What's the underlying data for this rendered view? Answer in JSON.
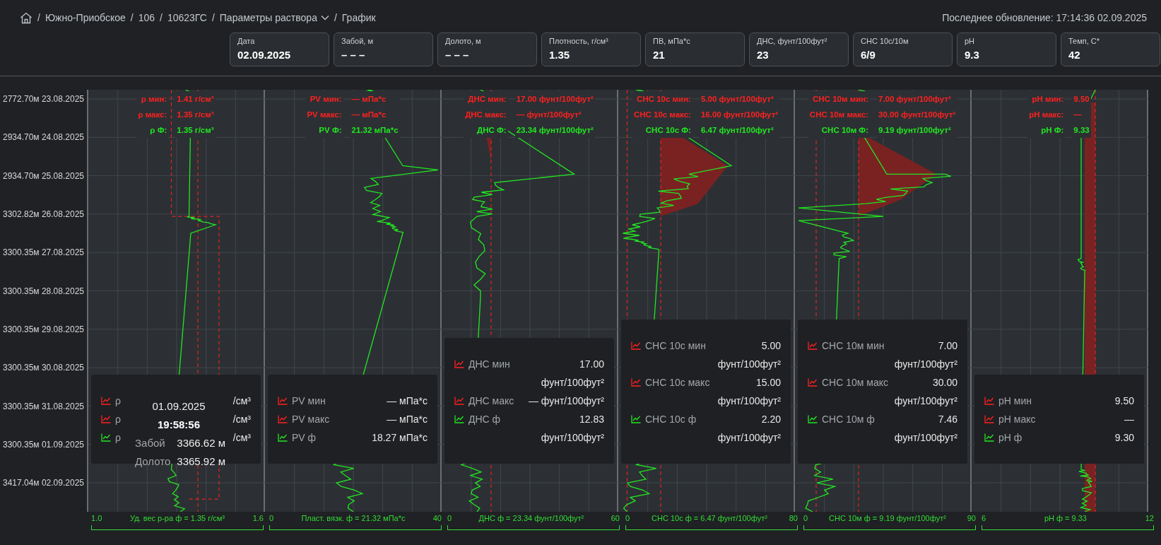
{
  "breadcrumb": {
    "separator": "/",
    "items": [
      {
        "label": "Южно-Приобское",
        "dropdown": false
      },
      {
        "label": "106",
        "dropdown": false
      },
      {
        "label": "10623ГС",
        "dropdown": false
      },
      {
        "label": "Параметры раствора",
        "dropdown": true
      },
      {
        "label": "График",
        "dropdown": false
      }
    ]
  },
  "last_update": "Последнее обновление: 17:14:36 02.09.2025",
  "stats": [
    {
      "label": "Дата",
      "value": "02.09.2025"
    },
    {
      "label": "Забой, м",
      "value": "– – –"
    },
    {
      "label": "Долото, м",
      "value": "– – –"
    },
    {
      "label": "Плотность, г/см³",
      "value": "1.35"
    },
    {
      "label": "ПВ, мПа*с",
      "value": "21"
    },
    {
      "label": "ДНС, фунт/100фут²",
      "value": "23"
    },
    {
      "label": "СНС 10с/10м",
      "value": "6/9"
    },
    {
      "label": "pH",
      "value": "9.3"
    },
    {
      "label": "Темп, C*",
      "value": "42"
    }
  ],
  "depth_axis": {
    "labels": [
      "2772.70м 23.08.2025",
      "2934.70м 24.08.2025",
      "2934.70м 25.08.2025",
      "3302.82м 26.08.2025",
      "3300.35м 27.08.2025",
      "3300.35м 28.08.2025",
      "3300.35м 29.08.2025",
      "3300.35м 30.08.2025",
      "3300.35м 31.08.2025",
      "3300.35м 01.09.2025",
      "3417.04м 02.09.2025"
    ]
  },
  "panels": [
    {
      "legend": [
        {
          "kind": "limit",
          "label": "ρ мин:",
          "value": "1.41 г/см³"
        },
        {
          "kind": "limit",
          "label": "ρ макс:",
          "value": "1.35 г/см³"
        },
        {
          "kind": "actual",
          "label": "ρ Ф:",
          "value": "1.35 г/см³"
        }
      ],
      "tooltip": {
        "rows": [
          {
            "kind": "limit",
            "label": "ρ",
            "value": "/см³"
          },
          {
            "kind": "limit",
            "label": "ρ",
            "value": "/см³"
          },
          {
            "kind": "actual",
            "label": "ρ",
            "value": "/см³"
          }
        ],
        "popup": {
          "date": "01.09.2025",
          "time": "19:58:56",
          "fields": [
            {
              "label": "Забой",
              "value": "3366.62 м"
            },
            {
              "label": "Долото",
              "value": "3365.92 м"
            }
          ]
        }
      },
      "axis": {
        "min": "1.0",
        "title": "Уд. вес р-ра ф = 1.35 г/см³",
        "max": "1.6"
      }
    },
    {
      "legend": [
        {
          "kind": "limit",
          "label": "PV мин:",
          "value": "— мПа*с"
        },
        {
          "kind": "limit",
          "label": "PV макс:",
          "value": "— мПа*с"
        },
        {
          "kind": "actual",
          "label": "PV Ф:",
          "value": "21.32 мПа*с"
        }
      ],
      "tooltip": {
        "rows": [
          {
            "kind": "limit",
            "label": "PV мин",
            "value": "— мПа*с"
          },
          {
            "kind": "limit",
            "label": "PV макс",
            "value": "— мПа*с"
          },
          {
            "kind": "actual",
            "label": "PV ф",
            "value": "18.27 мПа*с"
          }
        ]
      },
      "axis": {
        "min": "0",
        "title": "Пласт. вязк. ф = 21.32 мПа*с",
        "max": "40"
      }
    },
    {
      "legend": [
        {
          "kind": "limit",
          "label": "ДНС мин:",
          "value": "17.00 фунт/100фут²"
        },
        {
          "kind": "limit",
          "label": "ДНС макс:",
          "value": "— фунт/100фут²"
        },
        {
          "kind": "actual",
          "label": "ДНС Ф:",
          "value": "23.34 фунт/100фут²"
        }
      ],
      "tooltip": {
        "rows": [
          {
            "kind": "limit",
            "label": "ДНС мин",
            "value": "17.00 фунт/100фут²"
          },
          {
            "kind": "limit",
            "label": "ДНС макс",
            "value": "— фунт/100фут²"
          },
          {
            "kind": "actual",
            "label": "ДНС ф",
            "value": "12.83 фунт/100фут²"
          }
        ]
      },
      "axis": {
        "min": "0",
        "title": "ДНС ф = 23.34 фунт/100фут²",
        "max": "60"
      }
    },
    {
      "legend": [
        {
          "kind": "limit",
          "label": "СНС 10с мин:",
          "value": "5.00 фунт/100фут²"
        },
        {
          "kind": "limit",
          "label": "СНС 10с макс:",
          "value": "16.00 фунт/100фут²"
        },
        {
          "kind": "actual",
          "label": "СНС 10с Ф:",
          "value": "6.47 фунт/100фут²"
        }
      ],
      "tooltip": {
        "rows": [
          {
            "kind": "limit",
            "label": "СНС 10с мин",
            "value": "5.00 фунт/100фут²"
          },
          {
            "kind": "limit",
            "label": "СНС 10с макс",
            "value": "15.00 фунт/100фут²"
          },
          {
            "kind": "actual",
            "label": "СНС 10с ф",
            "value": "2.20 фунт/100фут²"
          }
        ]
      },
      "axis": {
        "min": "0",
        "title": "СНС 10с ф = 6.47 фунт/100фут²",
        "max": "80"
      }
    },
    {
      "legend": [
        {
          "kind": "limit",
          "label": "СНС 10м мин:",
          "value": "7.00 фунт/100фут²"
        },
        {
          "kind": "limit",
          "label": "СНС 10м макс:",
          "value": "30.00 фунт/100фут²"
        },
        {
          "kind": "actual",
          "label": "СНС 10м Ф:",
          "value": "9.19 фунт/100фут²"
        }
      ],
      "tooltip": {
        "rows": [
          {
            "kind": "limit",
            "label": "СНС 10м мин",
            "value": "7.00 фунт/100фут²"
          },
          {
            "kind": "limit",
            "label": "СНС 10м макс",
            "value": "30.00 фунт/100фут²"
          },
          {
            "kind": "actual",
            "label": "СНС 10м ф",
            "value": "7.46 фунт/100фут²"
          }
        ]
      },
      "axis": {
        "min": "0",
        "title": "СНС 10м ф = 9.19 фунт/100фут²",
        "max": "90"
      }
    },
    {
      "legend": [
        {
          "kind": "limit",
          "label": "pH мин:",
          "value": "9.50"
        },
        {
          "kind": "limit",
          "label": "pH макс:",
          "value": "—"
        },
        {
          "kind": "actual",
          "label": "pH Ф:",
          "value": "9.33"
        }
      ],
      "tooltip": {
        "rows": [
          {
            "kind": "limit",
            "label": "pH мин",
            "value": "9.50"
          },
          {
            "kind": "limit",
            "label": "pH макс",
            "value": "—"
          },
          {
            "kind": "actual",
            "label": "pH ф",
            "value": "9.30"
          }
        ]
      },
      "axis": {
        "min": "6",
        "title": "pH ф = 9.33",
        "max": "12"
      }
    }
  ]
}
